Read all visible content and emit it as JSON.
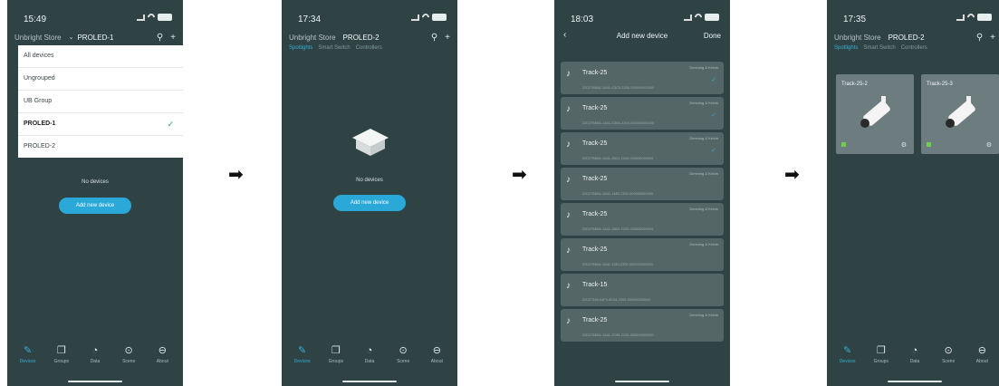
{
  "arrows": [
    "➡",
    "➡",
    "➡"
  ],
  "screens": [
    {
      "time": "15:49",
      "store": "Unbright Store",
      "current_group": "PROLED-1",
      "search_icon": "search-icon",
      "add_icon": "plus-icon",
      "dropdown": [
        {
          "label": "All devices",
          "selected": false
        },
        {
          "label": "Ungrouped",
          "selected": false
        },
        {
          "label": "UB Group",
          "selected": false
        },
        {
          "label": "PROLED-1",
          "selected": true
        },
        {
          "label": "PROLED-2",
          "selected": false
        }
      ],
      "check": "✓",
      "empty_text": "No devices",
      "add_button": "Add new device",
      "nav": [
        {
          "label": "Devices",
          "icon": "✎",
          "active": true
        },
        {
          "label": "Groups",
          "icon": "❐",
          "active": false
        },
        {
          "label": "Data",
          "icon": "◔",
          "active": false
        },
        {
          "label": "Scene",
          "icon": "⊙",
          "active": false
        },
        {
          "label": "About",
          "icon": "⊖",
          "active": false
        }
      ]
    },
    {
      "time": "17:34",
      "store": "Unbright Store",
      "current_group": "PROLED-2",
      "tabs": [
        "Spotlights",
        "Smart Switch",
        "Controllers"
      ],
      "empty_text": "No devices",
      "add_button": "Add new device",
      "nav": [
        {
          "label": "Devices",
          "icon": "✎",
          "active": true
        },
        {
          "label": "Groups",
          "icon": "❐",
          "active": false
        },
        {
          "label": "Data",
          "icon": "◔",
          "active": false
        },
        {
          "label": "Scene",
          "icon": "⊙",
          "active": false
        },
        {
          "label": "About",
          "icon": "⊖",
          "active": false
        }
      ]
    },
    {
      "time": "18:03",
      "title": "Add new device",
      "back": "‹",
      "done": "Done",
      "devices": [
        {
          "name": "Track-25",
          "type": "Dimming & Kelvin",
          "mac": "22D27B60A-1A41-C3C3-2200-000000000000",
          "checked": true
        },
        {
          "name": "Track-25",
          "type": "Dimming & Kelvin",
          "mac": "22D27B60A-1A41-D30A-2200-000000000000",
          "checked": true
        },
        {
          "name": "Track-25",
          "type": "Dimming & Kelvin",
          "mac": "22D27B60A-1A41-2B12-2200-000000000000",
          "checked": true
        },
        {
          "name": "Track-25",
          "type": "Dimming & Kelvin",
          "mac": "22D27B60A-1A41-1480-2200-000000000000",
          "checked": false
        },
        {
          "name": "Track-25",
          "type": "Dimming & Kelvin",
          "mac": "22D27B60A-1A41-1B02-2200-000000000000",
          "checked": false
        },
        {
          "name": "Track-25",
          "type": "Dimming & Kelvin",
          "mac": "22D27B60A-1A41-1180-2200-000000000000",
          "checked": false
        },
        {
          "name": "Track-15",
          "type": "",
          "mac": "22D27396-04F0-6D44-2200-000000000000",
          "checked": false
        },
        {
          "name": "Track-25",
          "type": "Dimming & Kelvin",
          "mac": "22D27B60A-1A41-2C98-2200-000000000000",
          "checked": false
        }
      ]
    },
    {
      "time": "17:35",
      "store": "Unbright Store",
      "current_group": "PROLED-2",
      "tabs": [
        "Spotlights",
        "Smart Switch",
        "Controllers"
      ],
      "tiles": [
        {
          "name": "Track-25-2"
        },
        {
          "name": "Track-25-3"
        }
      ],
      "nav": [
        {
          "label": "Devices",
          "icon": "✎",
          "active": true
        },
        {
          "label": "Groups",
          "icon": "❐",
          "active": false
        },
        {
          "label": "Data",
          "icon": "◔",
          "active": false
        },
        {
          "label": "Scene",
          "icon": "⊙",
          "active": false
        },
        {
          "label": "About",
          "icon": "⊖",
          "active": false
        }
      ]
    }
  ]
}
